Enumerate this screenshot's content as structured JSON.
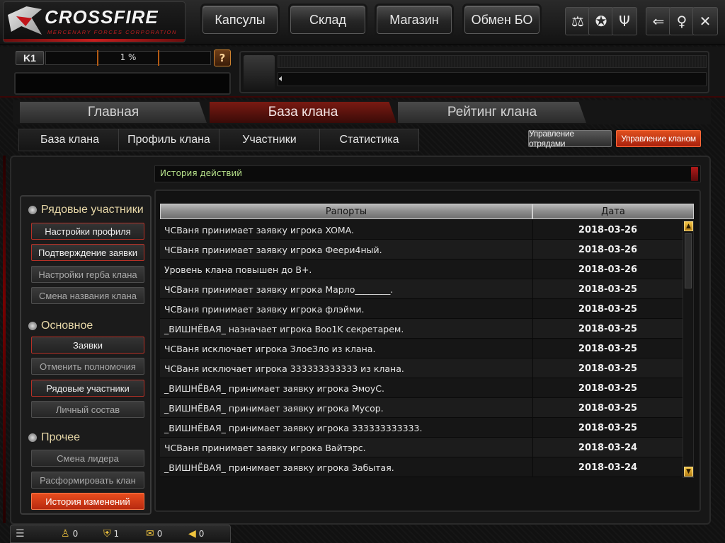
{
  "logo": {
    "name": "CROSSFIRE",
    "sub": "MERCENARY FORCES CORPORATION"
  },
  "topnav": [
    "Капсулы",
    "Склад",
    "Магазин",
    "Обмен БО"
  ],
  "top_icons": [
    "scales-icon",
    "star-badge-icon",
    "trident-icon",
    "exit-icon",
    "bulb-icon",
    "close-icon"
  ],
  "player": {
    "rank": "K1",
    "progress_text": "1 %",
    "help": "?"
  },
  "tabs": [
    "Главная",
    "База клана",
    "Рейтинг клана"
  ],
  "active_tab": "База клана",
  "subnav": [
    "База клана",
    "Профиль клана",
    "Участники",
    "Статистика"
  ],
  "actions": {
    "squads": "Управление отрядами",
    "clan": "Управление кланом"
  },
  "sidebar": {
    "sections": [
      {
        "title": "Рядовые участники",
        "items": [
          "Настройки профиля",
          "Подтверждение заявки",
          "Настройки герба клана",
          "Смена названия клана"
        ]
      },
      {
        "title": "Основное",
        "items": [
          "Заявки",
          "Отменить полномочия",
          "Рядовые участники",
          "Личный состав"
        ]
      },
      {
        "title": "Прочее",
        "items": [
          "Смена лидера",
          "Расформировать клан",
          "История изменений"
        ]
      }
    ]
  },
  "history": {
    "title": "История действий",
    "columns": [
      "Рапорты",
      "Дата"
    ],
    "rows": [
      {
        "text": "ЧСВаня принимает заявку игрока XOMA.",
        "date": "2018-03-26"
      },
      {
        "text": "ЧСВаня принимает заявку игрока Феери4ный.",
        "date": "2018-03-26"
      },
      {
        "text": "Уровень клана повышен до B+.",
        "date": "2018-03-26"
      },
      {
        "text": "ЧСВаня принимает заявку игрока Марло________.",
        "date": "2018-03-25"
      },
      {
        "text": "ЧСВаня принимает заявку игрока флэйми.",
        "date": "2018-03-25"
      },
      {
        "text": "_ВИШНЁВАЯ_ назначает игрока Boo1K секретарем.",
        "date": "2018-03-25"
      },
      {
        "text": "ЧСВаня исключает игрока ЗлоеЗло из клана.",
        "date": "2018-03-25"
      },
      {
        "text": "ЧСВаня исключает игрока 333333333333 из клана.",
        "date": "2018-03-25"
      },
      {
        "text": "_ВИШНЁВАЯ_ принимает заявку игрока ЭмоуС.",
        "date": "2018-03-25"
      },
      {
        "text": "_ВИШНЁВАЯ_ принимает заявку игрока Мусор.",
        "date": "2018-03-25"
      },
      {
        "text": "_ВИШНЁВАЯ_ принимает заявку игрока 333333333333.",
        "date": "2018-03-25"
      },
      {
        "text": "ЧСВаня принимает заявку игрока Вайтэрс.",
        "date": "2018-03-24"
      },
      {
        "text": "_ВИШНЁВАЯ_ принимает заявку игрока Забытая.",
        "date": "2018-03-24"
      }
    ]
  },
  "statusbar": [
    {
      "icon": "menu-icon",
      "value": ""
    },
    {
      "icon": "person-icon",
      "value": "0"
    },
    {
      "icon": "shield-icon",
      "value": "1"
    },
    {
      "icon": "chat-icon",
      "value": "0"
    },
    {
      "icon": "speaker-icon",
      "value": "0"
    }
  ],
  "colors": {
    "accent": "#c8321a",
    "history_title": "#b7e28b"
  }
}
